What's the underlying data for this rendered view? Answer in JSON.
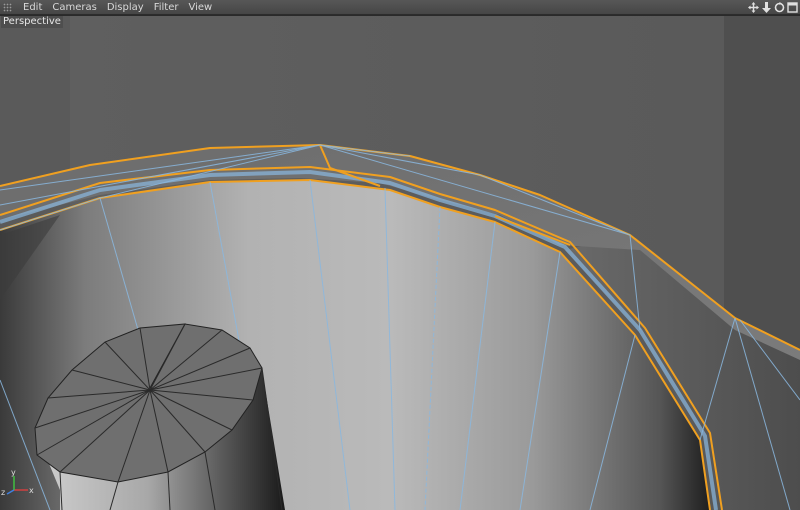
{
  "menubar": {
    "items": [
      "Edit",
      "Cameras",
      "Display",
      "Filter",
      "View"
    ],
    "icons": [
      "move-icon",
      "dolly-icon",
      "rotate-icon",
      "maximize-icon"
    ]
  },
  "viewport": {
    "label": "Perspective",
    "axis_labels": {
      "x": "x",
      "y": "y",
      "z": "z"
    }
  },
  "colors": {
    "selection": "#f0a020",
    "wire": "#8ab8e0",
    "background": "#555555"
  }
}
